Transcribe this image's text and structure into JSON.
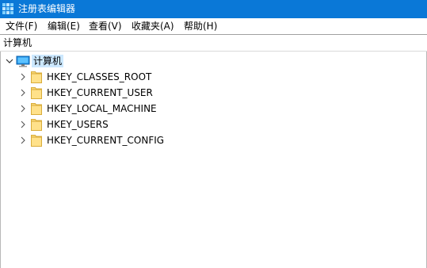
{
  "window": {
    "title": "注册表编辑器",
    "accent": "#0a78d7",
    "icon": "regedit-icon"
  },
  "menu": {
    "items": [
      {
        "label": "文件(F)"
      },
      {
        "label": "编辑(E)"
      },
      {
        "label": "查看(V)"
      },
      {
        "label": "收藏夹(A)"
      },
      {
        "label": "帮助(H)"
      }
    ]
  },
  "address": {
    "path": "计算机"
  },
  "tree": {
    "root": {
      "label": "计算机",
      "expanded": true,
      "selected": true,
      "icon": "computer-icon"
    },
    "nodes": [
      {
        "label": "HKEY_CLASSES_ROOT",
        "icon": "folder-icon"
      },
      {
        "label": "HKEY_CURRENT_USER",
        "icon": "folder-icon"
      },
      {
        "label": "HKEY_LOCAL_MACHINE",
        "icon": "folder-icon"
      },
      {
        "label": "HKEY_USERS",
        "icon": "folder-icon"
      },
      {
        "label": "HKEY_CURRENT_CONFIG",
        "icon": "folder-icon"
      }
    ]
  }
}
